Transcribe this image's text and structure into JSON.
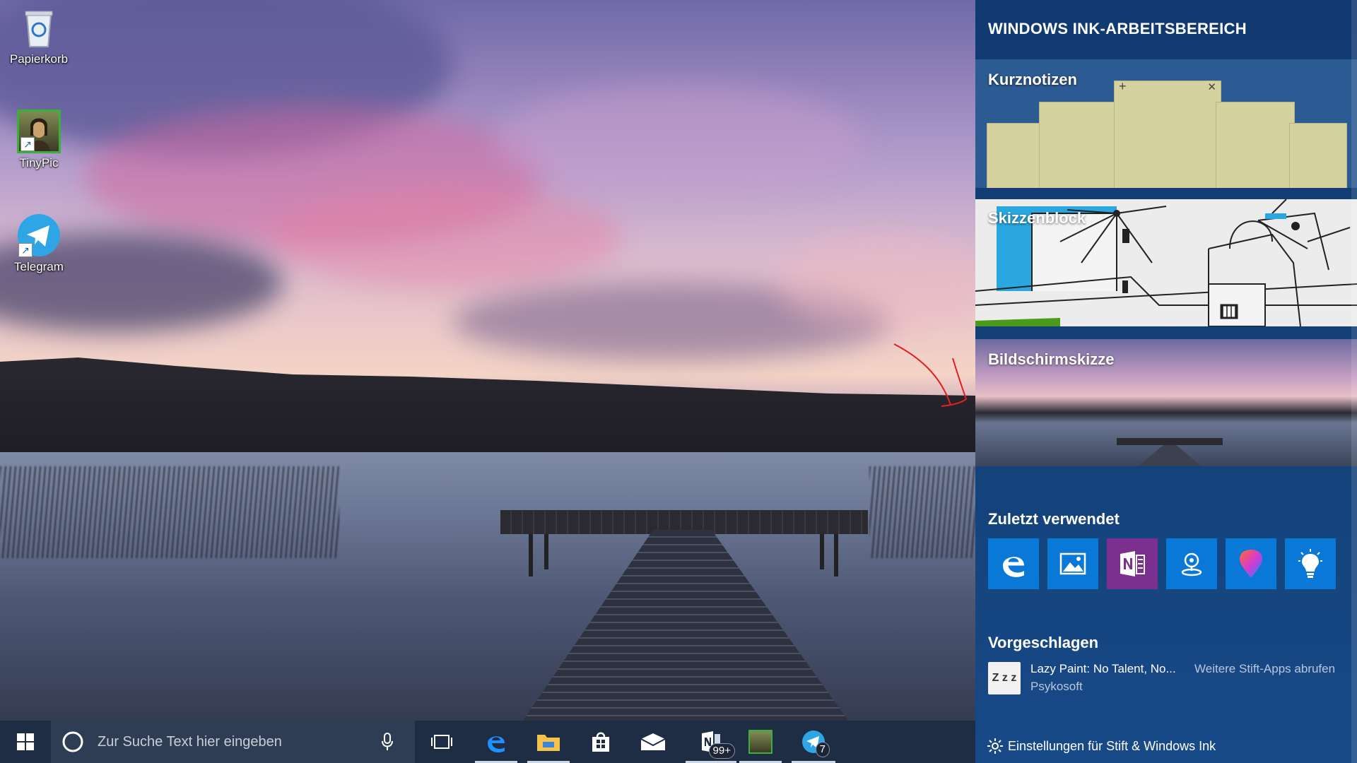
{
  "desktop": {
    "icons": [
      {
        "label": "Papierkorb"
      },
      {
        "label": "TinyPic"
      },
      {
        "label": "Telegram"
      }
    ]
  },
  "taskbar": {
    "search_placeholder": "Zur Suche Text hier eingeben",
    "onenote_badge": "99+",
    "telegram_badge": "7"
  },
  "ink_workspace": {
    "title": "WINDOWS INK-ARBEITSBEREICH",
    "tiles": {
      "sticky_notes": "Kurznotizen",
      "sketchpad": "Skizzenblock",
      "screen_sketch": "Bildschirmskizze"
    },
    "recent_title": "Zuletzt verwendet",
    "recent_apps": [
      "edge-icon",
      "photos-icon",
      "onenote-icon",
      "maps-icon",
      "paint3d-icon",
      "tips-icon"
    ],
    "suggested_title": "Vorgeschlagen",
    "suggestion": {
      "name": "Lazy Paint: No Talent, No...",
      "publisher": "Psykosoft",
      "icon_text": "Z z z",
      "more_link": "Weitere Stift-Apps abrufen"
    },
    "settings_link": "Einstellungen für Stift & Windows Ink"
  },
  "colors": {
    "panel": "#134078",
    "accent_blue": "#0a78d7",
    "onenote_purple": "#7b2f8e",
    "taskbar": "#1e2c44"
  }
}
